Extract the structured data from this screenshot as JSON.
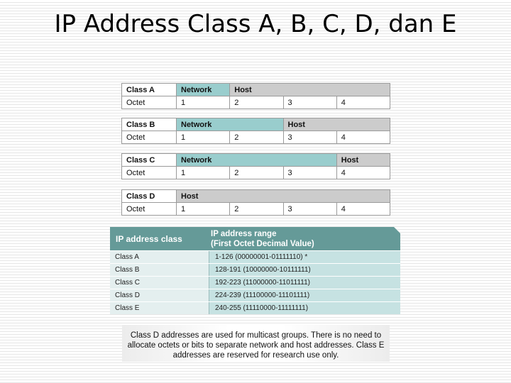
{
  "title": "IP Address Class A, B, C, D, dan E",
  "class_tables": [
    {
      "class_label": "Class A",
      "row_label": "Octet",
      "network_label": "Network",
      "host_label": "Host",
      "network_octets": 1,
      "octets": [
        "1",
        "2",
        "3",
        "4"
      ]
    },
    {
      "class_label": "Class B",
      "row_label": "Octet",
      "network_label": "Network",
      "host_label": "Host",
      "network_octets": 2,
      "octets": [
        "1",
        "2",
        "3",
        "4"
      ]
    },
    {
      "class_label": "Class C",
      "row_label": "Octet",
      "network_label": "Network",
      "host_label": "Host",
      "network_octets": 3,
      "octets": [
        "1",
        "2",
        "3",
        "4"
      ]
    },
    {
      "class_label": "Class D",
      "row_label": "Octet",
      "network_label": "",
      "host_label": "Host",
      "network_octets": 0,
      "octets": [
        "1",
        "2",
        "3",
        "4"
      ]
    }
  ],
  "range_table": {
    "header_class": "IP address class",
    "header_range_line1": "IP address range",
    "header_range_line2": "(First Octet Decimal Value)",
    "rows": [
      {
        "class": "Class A",
        "range": "1-126 (00000001-01111110) *"
      },
      {
        "class": "Class B",
        "range": "128-191 (10000000-10111111)"
      },
      {
        "class": "Class C",
        "range": "192-223 (11000000-11011111)"
      },
      {
        "class": "Class D",
        "range": "224-239 (11100000-11101111)"
      },
      {
        "class": "Class E",
        "range": "240-255 (11110000-11111111)"
      }
    ]
  },
  "note": {
    "line1": "Class D addresses are used for multicast groups. There is no need to",
    "line2": "allocate octets or bits to separate network and host addresses. Class E",
    "line3": "addresses are reserved for research use only."
  },
  "colors": {
    "network": "#99cdcd",
    "host": "#cccccc",
    "range_header": "#659a98",
    "range_cell": "#c6e2e2",
    "class_cell": "#e4efef"
  }
}
